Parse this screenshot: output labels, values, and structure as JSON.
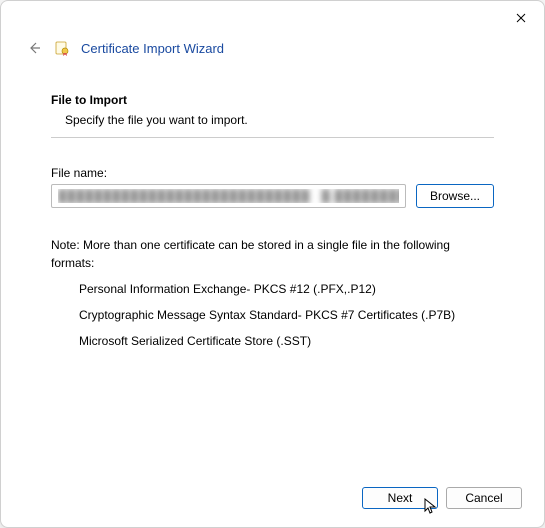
{
  "header": {
    "title": "Certificate Import Wizard"
  },
  "section": {
    "title": "File to Import",
    "subtitle": "Specify the file you want to import."
  },
  "file": {
    "label": "File name:",
    "value": "████████████████████████████   █.████████",
    "browse_label": "Browse..."
  },
  "note": "Note:  More than one certificate can be stored in a single file in the following formats:",
  "formats": [
    "Personal Information Exchange- PKCS #12 (.PFX,.P12)",
    "Cryptographic Message Syntax Standard- PKCS #7 Certificates (.P7B)",
    "Microsoft Serialized Certificate Store (.SST)"
  ],
  "buttons": {
    "next": "Next",
    "cancel": "Cancel"
  }
}
